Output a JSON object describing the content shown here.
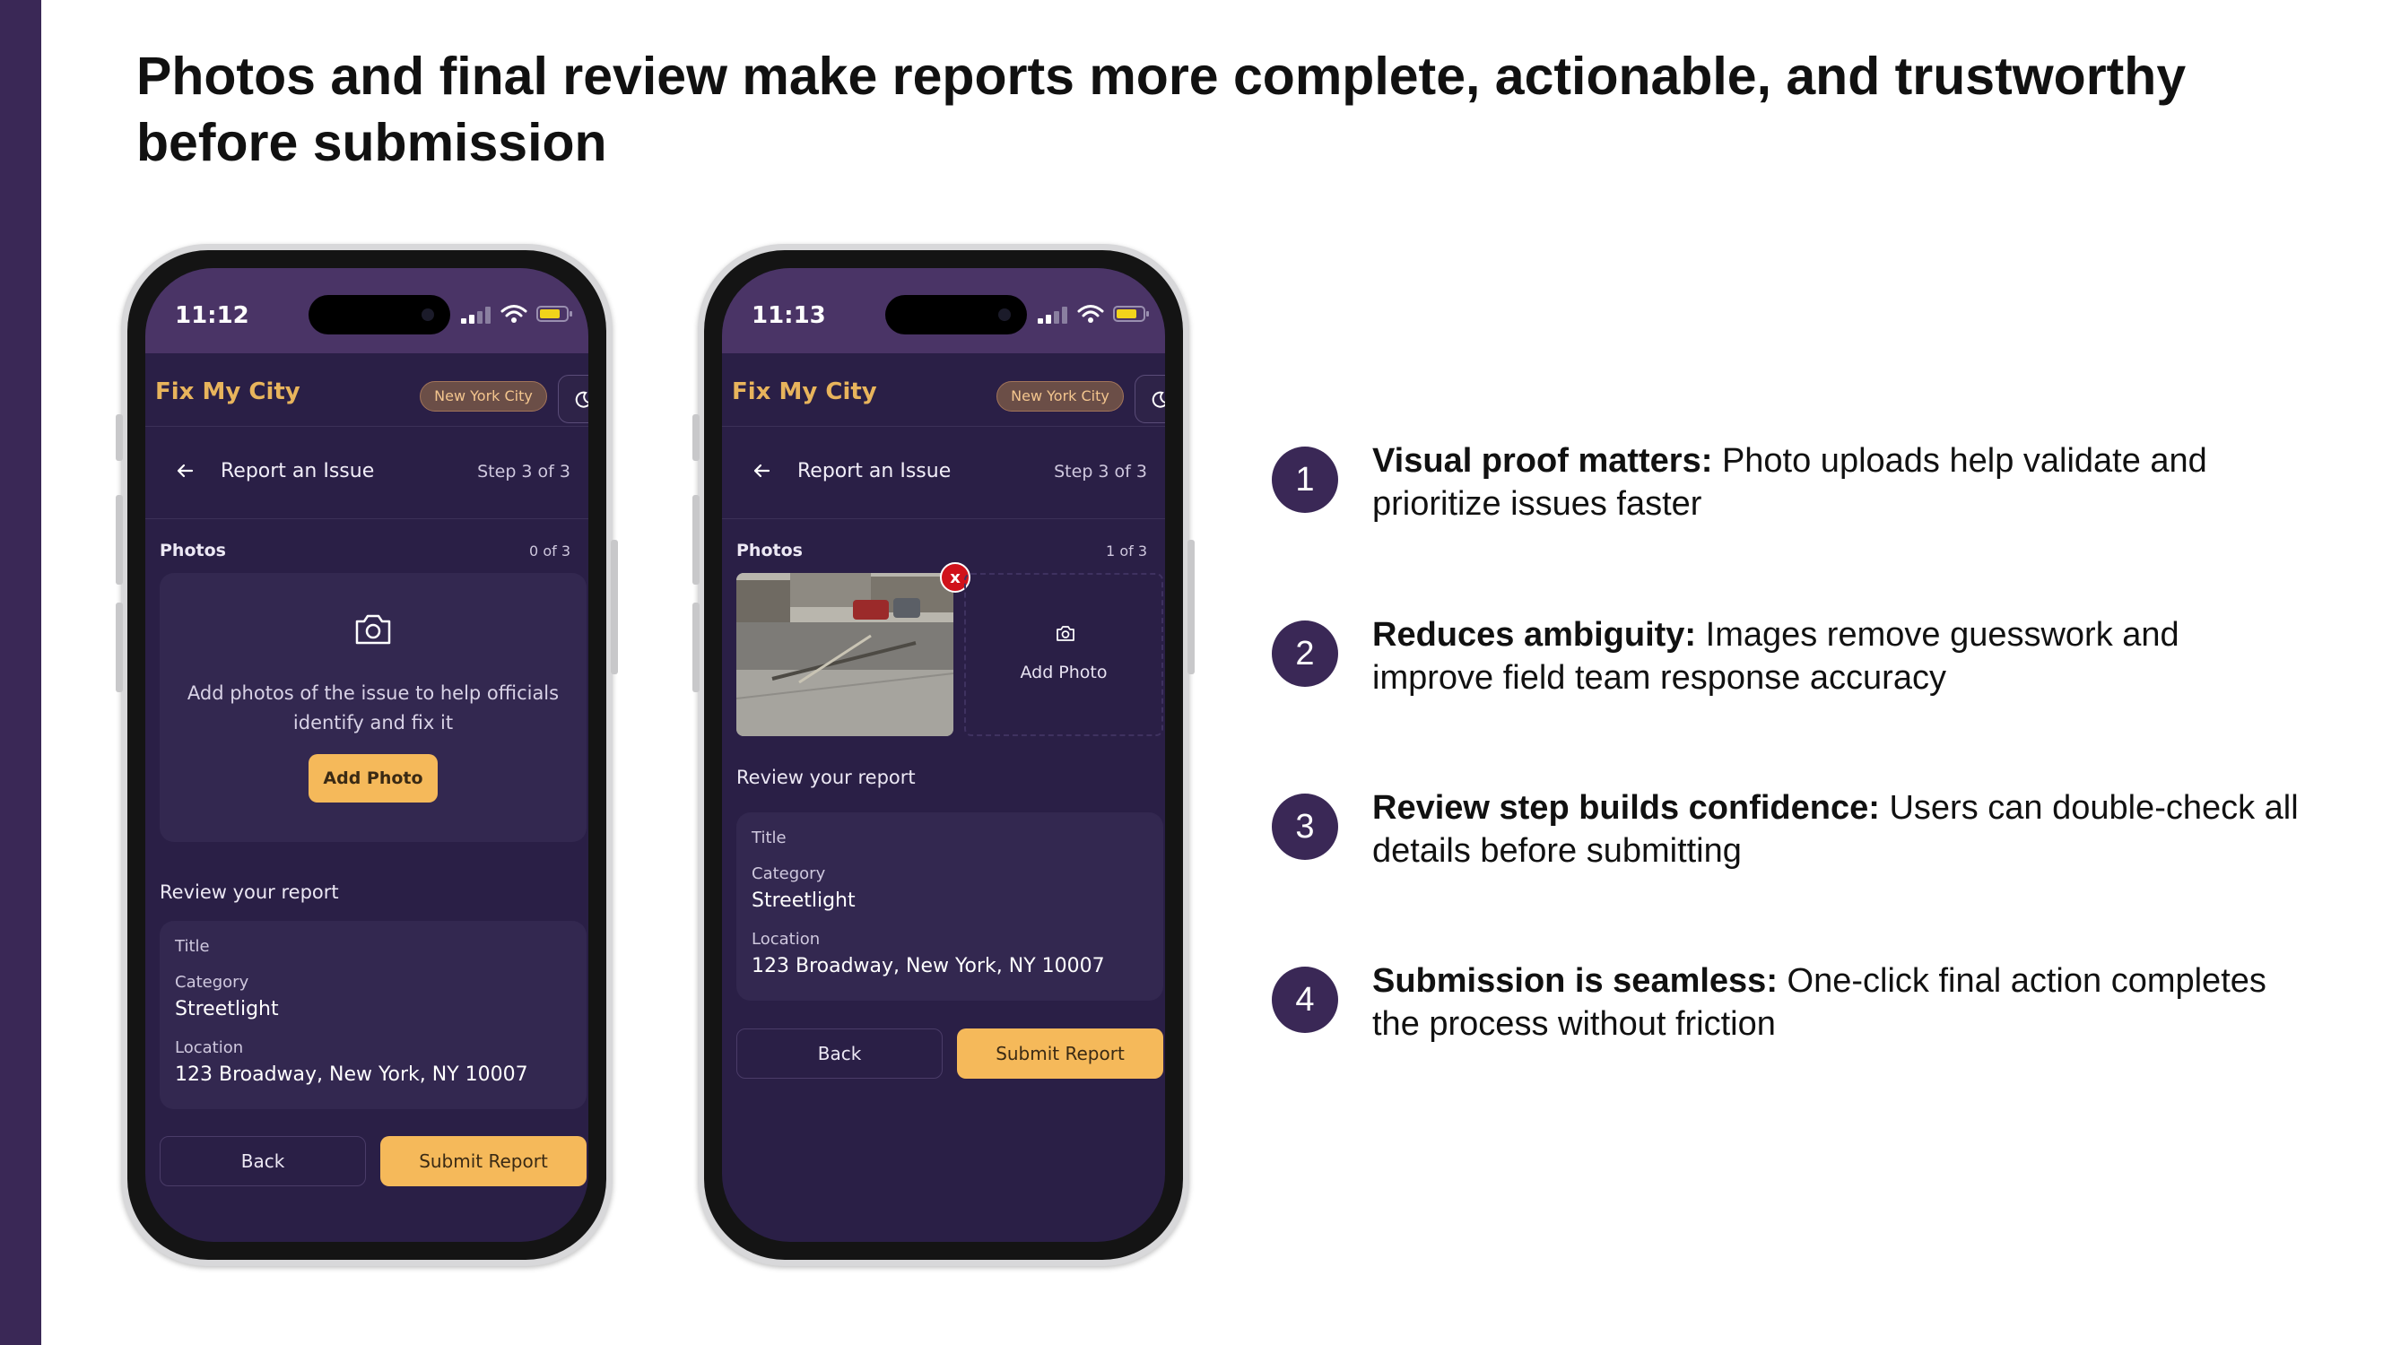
{
  "slide": {
    "title": "Photos and final review make reports more complete, actionable, and trustworthy before submission"
  },
  "colors": {
    "accent_purple": "#3a2856",
    "app_bg": "#2a1f46",
    "brand_orange": "#f5b95a",
    "remove_red": "#d0121b"
  },
  "phones": [
    {
      "time": "11:12",
      "app_name": "Fix My City",
      "city_badge": "New York City",
      "theme_toggle_icon": "moon-icon",
      "page_title": "Report an Issue",
      "step": "Step 3 of 3",
      "photos_label": "Photos",
      "photos_count": "0 of 3",
      "upload_hint": "Add photos of the issue to help officials identify and fix it",
      "add_photo_label": "Add Photo",
      "review_heading": "Review your report",
      "review": {
        "title_label": "Title",
        "category_label": "Category",
        "category_value": "Streetlight",
        "location_label": "Location",
        "location_value": "123 Broadway, New York, NY 10007"
      },
      "back_label": "Back",
      "submit_label": "Submit Report"
    },
    {
      "time": "11:13",
      "app_name": "Fix My City",
      "city_badge": "New York City",
      "theme_toggle_icon": "moon-icon",
      "page_title": "Report an Issue",
      "step": "Step 3 of 3",
      "photos_label": "Photos",
      "photos_count": "1 of 3",
      "remove_label": "x",
      "add_photo_label": "Add Photo",
      "review_heading": "Review your report",
      "review": {
        "title_label": "Title",
        "category_label": "Category",
        "category_value": "Streetlight",
        "location_label": "Location",
        "location_value": "123 Broadway, New York, NY 10007"
      },
      "back_label": "Back",
      "submit_label": "Submit Report"
    }
  ],
  "points": [
    {
      "num": "1",
      "bold": "Visual proof matters:",
      "text": " Photo uploads help validate and prioritize issues faster"
    },
    {
      "num": "2",
      "bold": "Reduces ambiguity:",
      "text": " Images remove guesswork and improve field team response accuracy"
    },
    {
      "num": "3",
      "bold": "Review step builds confidence:",
      "text": " Users can double-check all details before submitting"
    },
    {
      "num": "4",
      "bold": "Submission is seamless:",
      "text": " One-click final action completes the process without friction"
    }
  ]
}
